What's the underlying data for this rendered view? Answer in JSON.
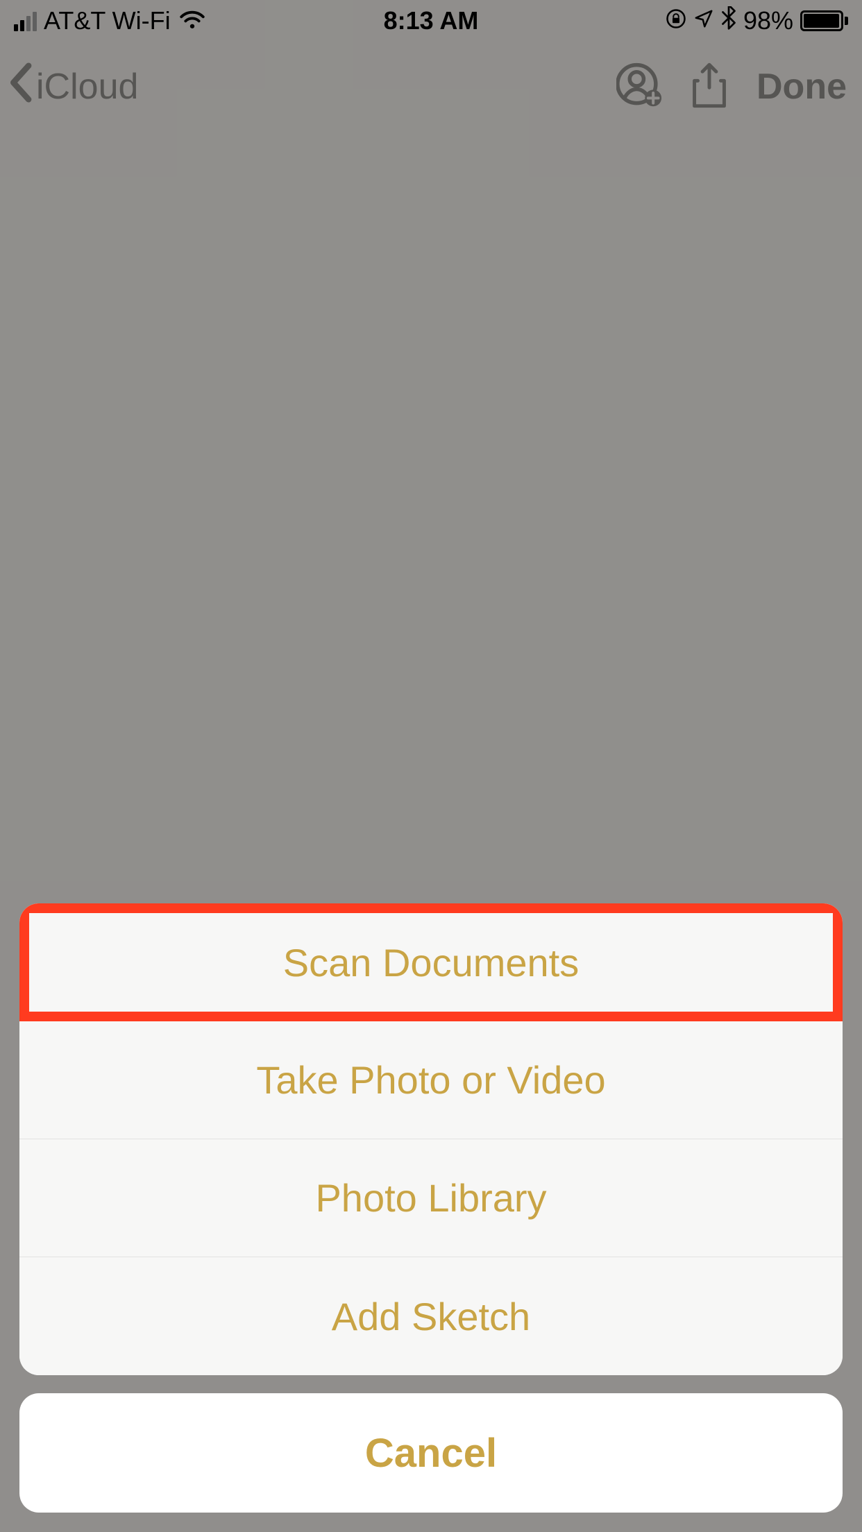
{
  "status_bar": {
    "carrier": "AT&T Wi-Fi",
    "time": "8:13 AM",
    "battery_percent": "98%"
  },
  "nav": {
    "back_label": "iCloud",
    "done_label": "Done"
  },
  "action_sheet": {
    "items": [
      {
        "label": "Scan Documents",
        "highlighted": true
      },
      {
        "label": "Take Photo or Video",
        "highlighted": false
      },
      {
        "label": "Photo Library",
        "highlighted": false
      },
      {
        "label": "Add Sketch",
        "highlighted": false
      }
    ],
    "cancel_label": "Cancel"
  },
  "colors": {
    "accent": "#c9a445",
    "highlight": "#ff3b1f"
  }
}
